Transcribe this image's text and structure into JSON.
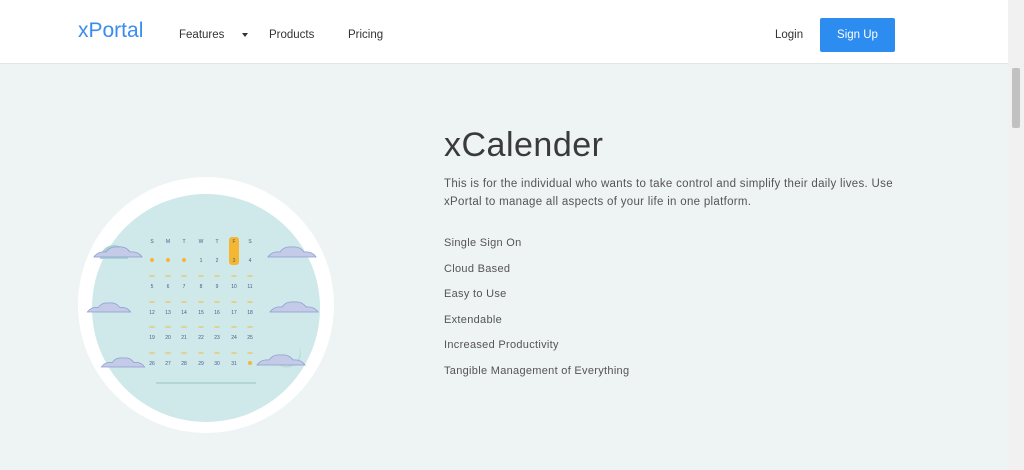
{
  "header": {
    "brand": "xPortal",
    "nav": {
      "features": "Features",
      "products": "Products",
      "pricing": "Pricing"
    },
    "login": "Login",
    "signup": "Sign Up"
  },
  "main": {
    "title": "xCalender",
    "description": "This is for the individual who wants to take control and simplify their daily lives. Use xPortal to manage all aspects of your life in one platform.",
    "features": [
      "Single Sign On",
      "Cloud Based",
      "Easy to Use",
      "Extendable",
      "Increased Productivity",
      "Tangible Management of Everything"
    ]
  },
  "calendar": {
    "weekdays": [
      "S",
      "M",
      "T",
      "W",
      "T",
      "F",
      "S"
    ],
    "rows": [
      [
        "",
        "",
        "",
        "1",
        "2",
        "3",
        "4"
      ],
      [
        "5",
        "6",
        "7",
        "8",
        "9",
        "10",
        "11"
      ],
      [
        "12",
        "13",
        "14",
        "15",
        "16",
        "17",
        "18"
      ],
      [
        "19",
        "20",
        "21",
        "22",
        "23",
        "24",
        "25"
      ],
      [
        "26",
        "27",
        "28",
        "29",
        "30",
        "31",
        ""
      ]
    ]
  },
  "colors": {
    "brand": "#3b8cf0",
    "button": "#2d8cf0",
    "page_bg": "#eef3f3",
    "circle": "#cfe8ea",
    "accent": "#f5b731",
    "cloud": "#c3cbe8",
    "number": "#4a5a8a"
  }
}
